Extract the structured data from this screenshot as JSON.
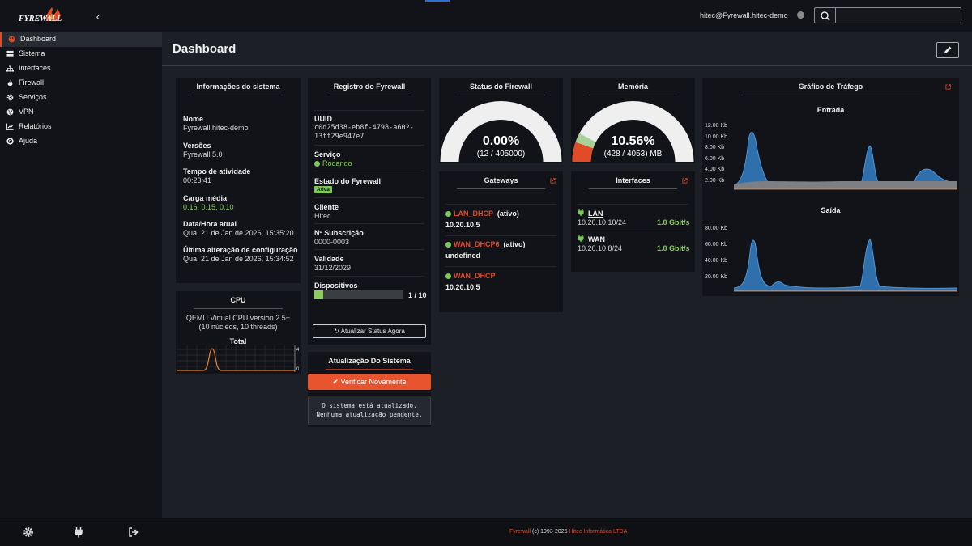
{
  "header": {
    "logo_text": "FYREWALL",
    "user": "hitec@Fyrewall.hitec-demo",
    "search": {
      "value": "",
      "placeholder": ""
    }
  },
  "sidebar": {
    "items": [
      {
        "label": "Dashboard",
        "icon": "palette-icon",
        "active": true
      },
      {
        "label": "Sistema",
        "icon": "server-icon"
      },
      {
        "label": "Interfaces",
        "icon": "sitemap-icon"
      },
      {
        "label": "Firewall",
        "icon": "fire-icon"
      },
      {
        "label": "Serviços",
        "icon": "cog-icon"
      },
      {
        "label": "VPN",
        "icon": "globe-icon"
      },
      {
        "label": "Relatórios",
        "icon": "chart-icon"
      },
      {
        "label": "Ajuda",
        "icon": "lifebuoy-icon"
      }
    ]
  },
  "page": {
    "title": "Dashboard"
  },
  "system_info": {
    "title": "Informações do sistema",
    "fields": [
      {
        "label": "Nome",
        "value": "Fyrewall.hitec-demo"
      },
      {
        "label": "Versões",
        "value": "Fyrewall 5.0"
      },
      {
        "label": "Tempo de atividade",
        "value": "00:23:41"
      },
      {
        "label": "Carga média",
        "value": "0.16, 0.15, 0.10"
      },
      {
        "label": "Data/Hora atual",
        "value": "Qua, 21 de Jan de 2026, 15:35:20"
      },
      {
        "label": "Última alteração de configuração",
        "value": "Qua, 21 de Jan de 2026, 15:34:52"
      }
    ]
  },
  "cpu": {
    "title": "CPU",
    "description": "QEMU Virtual CPU version 2.5+ (10 núcleos, 10 threads)",
    "chart_label": "Total",
    "axis_max": "4",
    "axis_min": "0"
  },
  "registry": {
    "title": "Registro do Fyrewall",
    "uuid_label": "UUID",
    "uuid_line1": "c0d25d38-eb8f-4798-a602-",
    "uuid_line2": "13ff29e947e7",
    "service_label": "Serviço",
    "service_value": "Rodando",
    "state_label": "Estado do Fyrewall",
    "state_badge": "Ativa",
    "client_label": "Cliente",
    "client_value": "Hitec",
    "subscription_label": "Nº Subscrição",
    "subscription_value": "0000-0003",
    "validity_label": "Validade",
    "validity_value": "31/12/2029",
    "devices_label": "Dispositivos",
    "devices_value": "1 / 10",
    "devices_used": 1,
    "devices_total": 10,
    "refresh_button": "Atualizar Status Agora"
  },
  "update": {
    "title": "Atualização Do Sistema",
    "check_button": "Verificar Novamente",
    "message_line1": "O sistema está atualizado.",
    "message_line2": "Nenhuma atualização pendente."
  },
  "firewall_status": {
    "title": "Status do Firewall",
    "percent": "0.00%",
    "detail": "(12 / 405000)",
    "fraction": 0.0
  },
  "memory": {
    "title": "Memória",
    "percent": "10.56%",
    "detail": "(428 / 4053) MB",
    "fraction": 0.1056
  },
  "gateways": {
    "title": "Gateways",
    "items": [
      {
        "name": "LAN_DHCP",
        "status": "(ativo)",
        "address": "10.20.10.5"
      },
      {
        "name": "WAN_DHCP6",
        "status": "(ativo)",
        "address": "undefined"
      },
      {
        "name": "WAN_DHCP",
        "status": "",
        "address": "10.20.10.5"
      }
    ]
  },
  "interfaces": {
    "title": "Interfaces",
    "items": [
      {
        "name": "LAN",
        "address": "10.20.10.10/24",
        "speed": "1.0 Gbit/s"
      },
      {
        "name": "WAN",
        "address": "10.20.10.8/24",
        "speed": "1.0 Gbit/s"
      }
    ]
  },
  "traffic": {
    "title": "Gráfico de Tráfego",
    "in_label": "Entrada",
    "out_label": "Saída",
    "in_ticks": [
      "12.00 Kb",
      "10.00 Kb",
      "8.00 Kb",
      "6.00 Kb",
      "4.00 Kb",
      "2.00 Kb"
    ],
    "out_ticks": [
      "80.00 Kb",
      "60.00 Kb",
      "40.00 Kb",
      "20.00 Kb"
    ],
    "colors": {
      "series_a": "#2f6fab",
      "series_b": "#8a8a8a",
      "series_c": "#e07b2a"
    }
  },
  "footer": {
    "brand": "Fyrewall",
    "copy": " (c) 1993-2025 ",
    "company": "Hitec Informática LTDA"
  },
  "colors": {
    "accent": "#e04b28",
    "ok": "#7bc75a",
    "panel": "#111318",
    "background": "#1c1f26"
  }
}
